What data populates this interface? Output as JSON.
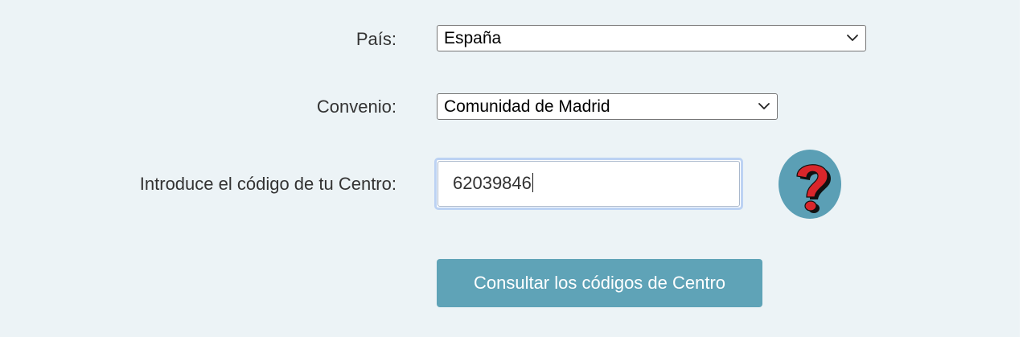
{
  "form": {
    "pais": {
      "label": "País:",
      "selected": "España"
    },
    "convenio": {
      "label": "Convenio:",
      "selected": "Comunidad de Madrid"
    },
    "codigo": {
      "label": "Introduce el código de tu Centro:",
      "value": "62039846"
    },
    "help_icon": "question-mark-icon",
    "submit_label": "Consultar los códigos de Centro"
  },
  "colors": {
    "background": "#ecf3f6",
    "button": "#5fa3b7",
    "focus_ring": "#bcd2f3",
    "help_circle": "#5b9fb5",
    "help_mark": "#d9262b"
  }
}
